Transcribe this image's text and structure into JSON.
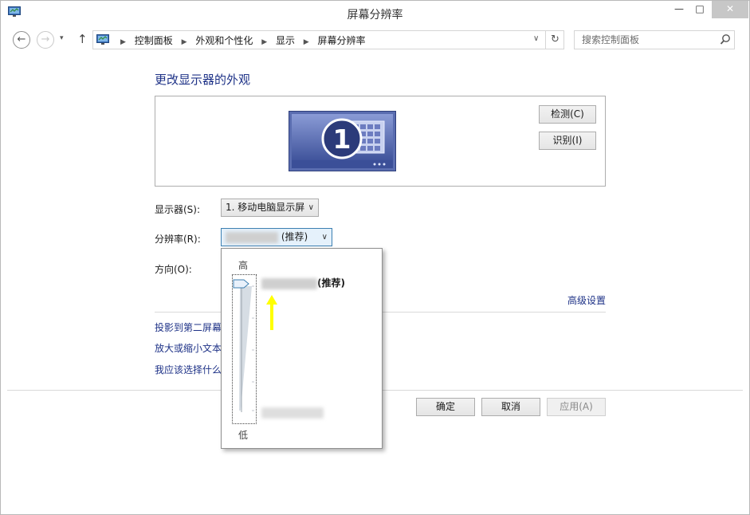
{
  "window": {
    "title": "屏幕分辨率",
    "controls": {
      "minimize": "—",
      "maximize": "□",
      "close": "✕"
    }
  },
  "navbar": {
    "back_glyph": "←",
    "forward_glyph": "→",
    "recent_glyph": "▾",
    "up_glyph": "↑",
    "breadcrumb": [
      "控制面板",
      "外观和个性化",
      "显示",
      "屏幕分辨率"
    ],
    "crumb_separator": "▶",
    "dropdown_glyph": "∨",
    "refresh_glyph": "↻",
    "search_placeholder": "搜索控制面板"
  },
  "main": {
    "heading": "更改显示器的外观",
    "monitor_number": "1",
    "detect_label": "检测(C)",
    "identify_label": "识别(I)",
    "display_label": "显示器(S):",
    "display_value": "1. 移动电脑显示屏",
    "resolution_label": "分辨率(R):",
    "resolution_suffix": "(推荐)",
    "orientation_label": "方向(O):",
    "advanced_link": "高级设置",
    "links": [
      "投影到第二屏幕",
      "放大或缩小文本",
      "我应该选择什么"
    ]
  },
  "footer": {
    "ok_label": "确定",
    "cancel_label": "取消",
    "apply_label": "应用(A)"
  },
  "popup": {
    "high_label": "高",
    "low_label": "低",
    "recommended_suffix": "(推荐)",
    "slider_position": 1.0
  },
  "colors": {
    "link": "#1e3287",
    "close_button": "#c7c7c7",
    "indicator_arrow": "#ffff00",
    "monitor_blue": "#5a6db0"
  },
  "icons": [
    "control-panel-icon",
    "search-icon",
    "refresh-icon",
    "back-icon",
    "forward-icon",
    "up-icon",
    "slider-thumb-icon",
    "yellow-arrow-icon"
  ]
}
